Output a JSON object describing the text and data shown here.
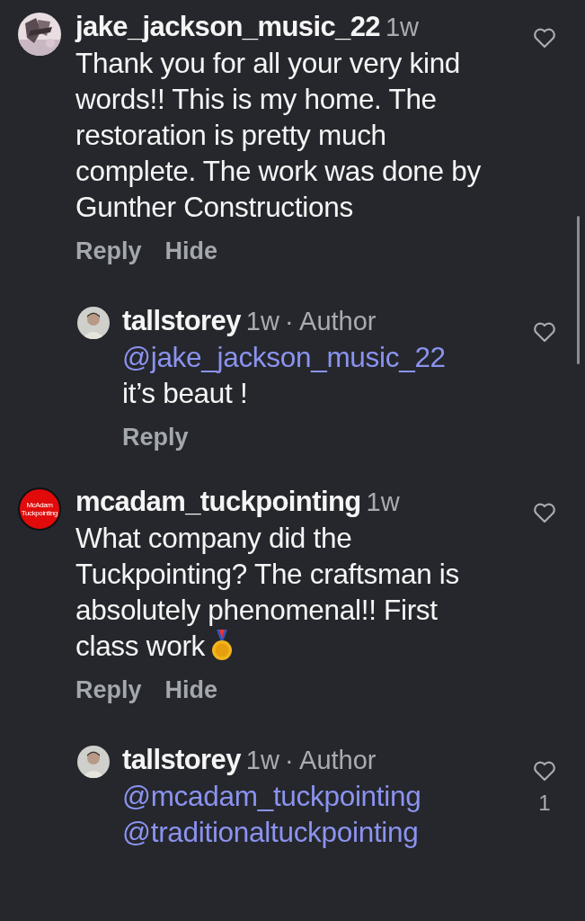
{
  "comments": [
    {
      "kind": "top",
      "avatar": {
        "kind": "picture"
      },
      "username": "jake_jackson_music_22",
      "time": "1w",
      "body": [
        {
          "kind": "text",
          "text": "Thank you for all your very kind words!! This is my home. The restoration is pretty much complete. The work was done by Gunther Constructions"
        }
      ],
      "actions": [
        "Reply",
        "Hide"
      ]
    },
    {
      "kind": "reply",
      "avatar": {
        "kind": "person"
      },
      "username": "tallstorey",
      "time": "1w",
      "author_label": "· Author",
      "body": [
        {
          "kind": "mention",
          "text": "@jake_jackson_music_22"
        },
        {
          "kind": "text",
          "text": "it’s beaut !"
        }
      ],
      "actions": [
        "Reply"
      ]
    },
    {
      "kind": "top",
      "avatar": {
        "kind": "logo",
        "text": "McAdam Tuckpointing"
      },
      "username": "mcadam_tuckpointing",
      "time": "1w",
      "body": [
        {
          "kind": "text",
          "text": "What company did the Tuckpointing? The craftsman is absolutely phenomenal!! First"
        },
        {
          "kind": "text",
          "text": "class work"
        },
        {
          "kind": "medal"
        }
      ],
      "actions": [
        "Reply",
        "Hide"
      ]
    },
    {
      "kind": "reply",
      "avatar": {
        "kind": "person"
      },
      "username": "tallstorey",
      "time": "1w",
      "author_label": "· Author",
      "body": [
        {
          "kind": "mention",
          "text": "@mcadam_tuckpointing"
        },
        {
          "kind": "mention",
          "text": "@traditionaltuckpointing"
        }
      ],
      "likes": "1"
    }
  ]
}
